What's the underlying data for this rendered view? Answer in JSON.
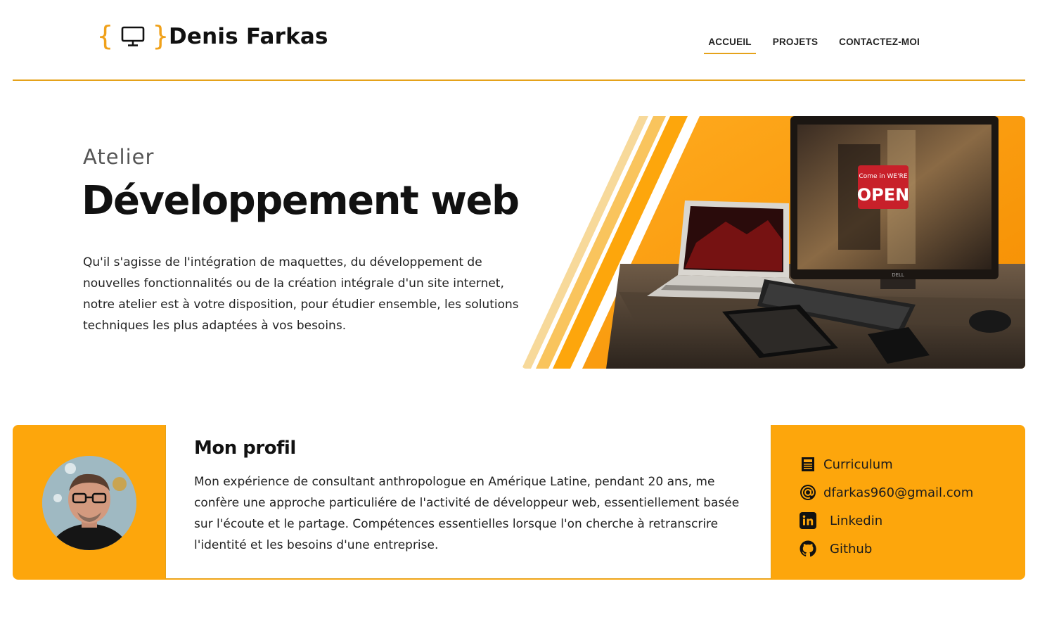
{
  "header": {
    "brace_open": "{",
    "brace_close": "}",
    "logo_icon": "monitor-icon",
    "brand": "Denis Farkas",
    "nav": [
      {
        "label": "ACCUEIL",
        "active": true
      },
      {
        "label": "PROJETS",
        "active": false
      },
      {
        "label": "CONTACTEZ-MOI",
        "active": false
      }
    ]
  },
  "hero": {
    "subtitle": "Atelier",
    "title": "Développement web",
    "text": "Qu'il s'agisse de l'intégration de maquettes, du développement de nouvelles fonctionnalités ou de la création intégrale d'un site internet, notre atelier est à votre disposition, pour étudier ensemble, les solutions techniques les plus adaptées à vos besoins.",
    "image_sign_line1": "Come in WE'RE",
    "image_sign_line2": "OPEN",
    "image_brand": "DELL"
  },
  "profile": {
    "title": "Mon profil",
    "text": "Mon expérience de consultant anthropologue en Amérique Latine, pendant 20 ans, me confère une approche particuliére de l'activité de développeur web, essentiellement basée sur l'écoute et le partage. Compétences essentielles lorsque l'on cherche à retranscrire l'identité et les besoins d'une entreprise.",
    "links": [
      {
        "icon": "cv-document-icon",
        "label": "Curriculum"
      },
      {
        "icon": "at-sign-icon",
        "label": "dfarkas960@gmail.com"
      },
      {
        "icon": "linkedin-icon",
        "label": "Linkedin"
      },
      {
        "icon": "github-icon",
        "label": "Github"
      }
    ]
  },
  "colors": {
    "accent": "#fda60c",
    "border": "#e5a21a",
    "text": "#111111"
  }
}
